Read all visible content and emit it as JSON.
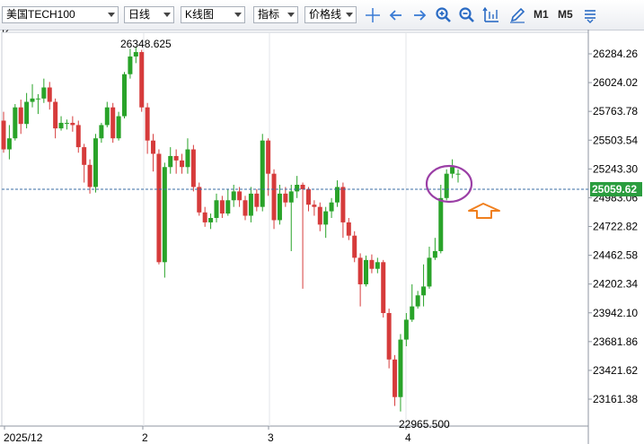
{
  "toolbar": {
    "symbol": "美国TECH100",
    "period": "日线",
    "chart_type": "K线图",
    "indicator": "指标",
    "price_line": "价格线",
    "m1": "M1",
    "m5": "M5",
    "icons": [
      "crosshair-icon",
      "scroll-left-icon",
      "scroll-right-icon",
      "zoom-in-icon",
      "zoom-out-icon",
      "fit-axis-icon",
      "draw-pen-icon",
      "menu-icon"
    ]
  },
  "chart_label": "K",
  "chart_data": {
    "type": "candlestick",
    "x_labels": [
      "2025/12",
      "2",
      "3",
      "4"
    ],
    "y_ticks": [
      26284.26,
      26024.02,
      25763.78,
      25503.54,
      25243.3,
      24983.06,
      24722.82,
      24462.58,
      24202.34,
      23942.1,
      23681.86,
      23421.62,
      23161.38
    ],
    "y_tick_labels": [
      "26284.26",
      "26024.02",
      "25763.78",
      "25503.54",
      "25243.30",
      "24983.06",
      "24722.82",
      "24462.58",
      "24202.34",
      "23942.10",
      "23681.86",
      "23421.62",
      "23161.38"
    ],
    "ylim": [
      22960,
      26415
    ],
    "current_price": 25059.62,
    "current_price_label": "25059.62",
    "high_label": "26348.625",
    "low_label": "22965.500",
    "colors": {
      "up": "#29a329",
      "down": "#d63b3b",
      "price_line": "#3a6ea5",
      "price_tag": "#2a9d3e",
      "circle": "#9b3fa6",
      "arrow": "#f07f1e"
    },
    "candles": [
      [
        25680,
        25420,
        25760,
        25390
      ],
      [
        25420,
        25520,
        25640,
        25330
      ],
      [
        25520,
        25800,
        25830,
        25500
      ],
      [
        25800,
        25650,
        25870,
        25560
      ],
      [
        25650,
        25850,
        25930,
        25610
      ],
      [
        25850,
        25880,
        26010,
        25800
      ],
      [
        25880,
        25880,
        25920,
        25740
      ],
      [
        25880,
        25980,
        26060,
        25840
      ],
      [
        25980,
        25850,
        26030,
        25780
      ],
      [
        25850,
        25610,
        25880,
        25520
      ],
      [
        25610,
        25660,
        25720,
        25590
      ],
      [
        25660,
        25660,
        25690,
        25600
      ],
      [
        25660,
        25640,
        25720,
        25580
      ],
      [
        25640,
        25440,
        25680,
        25390
      ],
      [
        25440,
        25280,
        25470,
        25120
      ],
      [
        25280,
        25080,
        25330,
        25020
      ],
      [
        25080,
        25520,
        25560,
        25030
      ],
      [
        25520,
        25640,
        25660,
        25480
      ],
      [
        25640,
        25800,
        25850,
        25620
      ],
      [
        25800,
        25520,
        25840,
        25480
      ],
      [
        25520,
        25720,
        25760,
        25500
      ],
      [
        25720,
        26100,
        26120,
        25700
      ],
      [
        26100,
        26260,
        26330,
        26060
      ],
      [
        26260,
        26300,
        26348,
        26200
      ],
      [
        26300,
        25800,
        26320,
        25760
      ],
      [
        25800,
        25500,
        25840,
        25380
      ],
      [
        25500,
        25380,
        25560,
        25220
      ],
      [
        25380,
        24400,
        25420,
        24380
      ],
      [
        24400,
        25260,
        25300,
        24260
      ],
      [
        25260,
        25360,
        25440,
        25200
      ],
      [
        25360,
        25320,
        25420,
        25200
      ],
      [
        25320,
        25260,
        25380,
        25200
      ],
      [
        25260,
        25420,
        25520,
        25200
      ],
      [
        25420,
        25080,
        25460,
        25040
      ],
      [
        25080,
        24850,
        25120,
        24820
      ],
      [
        24850,
        24760,
        24900,
        24720
      ],
      [
        24760,
        24800,
        24840,
        24700
      ],
      [
        24800,
        24960,
        25020,
        24760
      ],
      [
        24960,
        24840,
        25000,
        24800
      ],
      [
        24840,
        24960,
        25060,
        24820
      ],
      [
        24960,
        25040,
        25100,
        24900
      ],
      [
        25040,
        24960,
        25080,
        24900
      ],
      [
        24960,
        24820,
        25000,
        24780
      ],
      [
        24820,
        25020,
        25080,
        24760
      ],
      [
        25020,
        24900,
        25060,
        24860
      ],
      [
        24900,
        25500,
        25560,
        24860
      ],
      [
        25500,
        25200,
        25520,
        25000
      ],
      [
        25200,
        24780,
        25240,
        24700
      ],
      [
        24780,
        25020,
        25100,
        24740
      ],
      [
        25020,
        24940,
        25080,
        24900
      ],
      [
        24940,
        25040,
        25100,
        24500
      ],
      [
        25040,
        25100,
        25180,
        24980
      ],
      [
        25100,
        25060,
        25120,
        24160
      ],
      [
        25060,
        24920,
        25080,
        24860
      ],
      [
        24920,
        24900,
        24960,
        24820
      ],
      [
        24900,
        24740,
        24940,
        24680
      ],
      [
        24740,
        24860,
        24900,
        24620
      ],
      [
        24860,
        24940,
        24980,
        24800
      ],
      [
        24940,
        25080,
        25140,
        24900
      ],
      [
        25080,
        24760,
        25120,
        24620
      ],
      [
        24760,
        24640,
        24800,
        24600
      ],
      [
        24640,
        24440,
        24680,
        24400
      ],
      [
        24440,
        24200,
        24480,
        24000
      ],
      [
        24200,
        24420,
        24460,
        24180
      ],
      [
        24420,
        24340,
        24470,
        24300
      ],
      [
        24340,
        24400,
        24440,
        24300
      ],
      [
        24400,
        23940,
        24420,
        23900
      ],
      [
        23940,
        23520,
        23980,
        23440
      ],
      [
        23520,
        23180,
        23560,
        23100
      ],
      [
        23180,
        23700,
        23750,
        23050
      ],
      [
        23700,
        23880,
        23940,
        23640
      ],
      [
        23880,
        24000,
        24200,
        23860
      ],
      [
        24000,
        24100,
        24140,
        23980
      ],
      [
        24100,
        24180,
        24380,
        24000
      ],
      [
        24180,
        24440,
        24540,
        24160
      ],
      [
        24440,
        24500,
        24620,
        24420
      ],
      [
        24500,
        24980,
        25100,
        24480
      ],
      [
        24980,
        25200,
        25240,
        24960
      ],
      [
        25200,
        25260,
        25330,
        25160
      ],
      [
        25200,
        25200,
        25240,
        25120
      ]
    ]
  },
  "notes": {
    "circle": "",
    "arrow": ""
  }
}
